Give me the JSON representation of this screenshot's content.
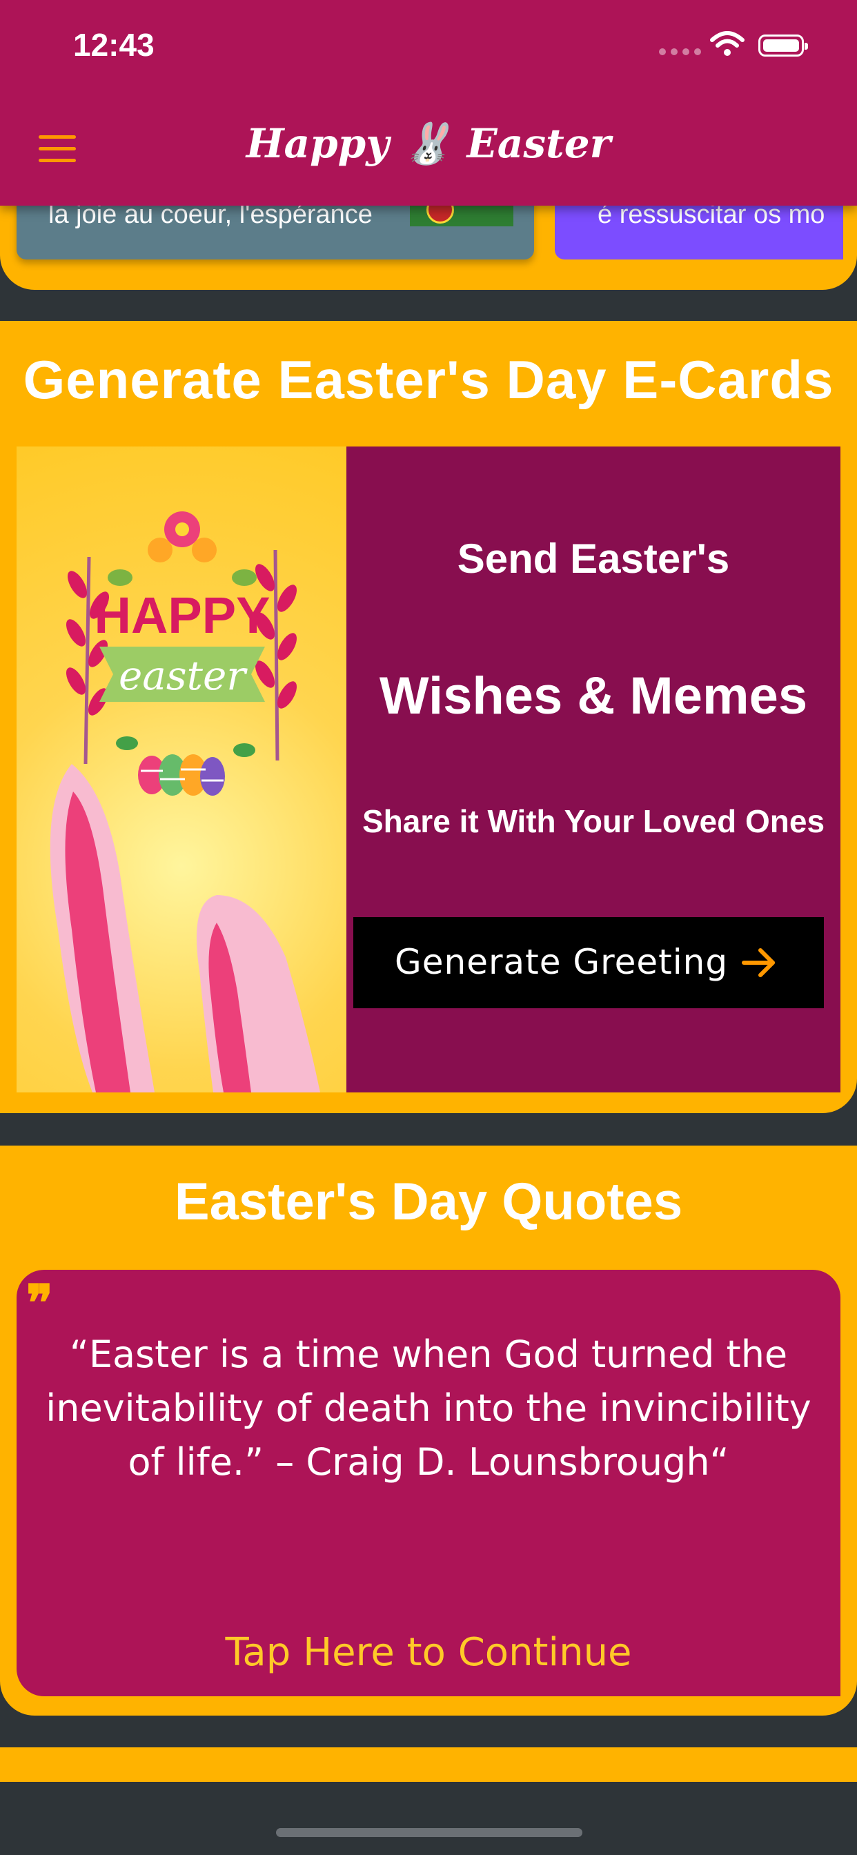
{
  "status_bar": {
    "time": "12:43"
  },
  "header": {
    "title": "Happy 🐰 Easter"
  },
  "slider": {
    "slide1_text": "la joie au coeur, l'espérance",
    "slide2_text": "é ressuscitar os mo"
  },
  "ecard": {
    "title": "Generate Easter's Day E-Cards",
    "image_text": {
      "happy": "HAPPY",
      "easter": "easter"
    },
    "send_line": "Send Easter's",
    "wishes_line": "Wishes & Memes",
    "share_line": "Share it With Your Loved Ones",
    "button_label": "Generate Greeting"
  },
  "quotes": {
    "title": "Easter's Day Quotes",
    "quote_mark": "❞",
    "quote": "“Easter is a time when God turned the inevitability of death into the invincibility of life.” – Craig D. Lounsbrough“",
    "continue_label": "Tap Here to Continue"
  },
  "colors": {
    "header": "#ad1457",
    "section_bg": "#ffb300",
    "ecard_panel": "#880e4f",
    "accent_arrow": "#ff9800"
  }
}
